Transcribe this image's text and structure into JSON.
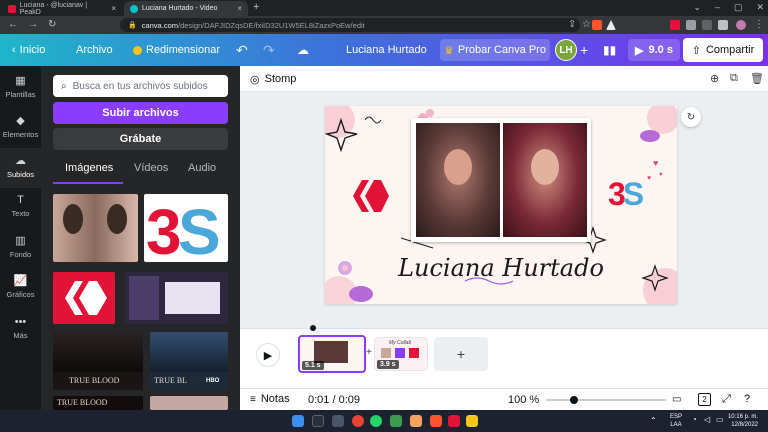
{
  "browser": {
    "tabs": [
      {
        "title": "Luciana - @lucianav | PeakD",
        "active": false
      },
      {
        "title": "Luciana Hurtado - Video",
        "active": true
      }
    ],
    "new_tab_icon": "plus-icon",
    "url_host": "canva.com",
    "url_path": "/design/DAFJIDZqsDE/fxiID32U1W5EL8iZazxPoEw/edit"
  },
  "topbar": {
    "home_label": "Inicio",
    "file_label": "Archivo",
    "resize_label": "Redimensionar",
    "doc_title": "Luciana Hurtado",
    "try_pro_label": "Probar Canva Pro",
    "avatar_initials": "LH",
    "duration_label": "9.0 s",
    "share_label": "Compartir"
  },
  "rail": {
    "items": [
      {
        "label": "Plantillas",
        "icon": "template-icon"
      },
      {
        "label": "Elementos",
        "icon": "elements-icon"
      },
      {
        "label": "Subidos",
        "icon": "cloud-upload-icon"
      },
      {
        "label": "Texto",
        "icon": "text-icon"
      },
      {
        "label": "Fondo",
        "icon": "background-icon"
      },
      {
        "label": "Gráficos",
        "icon": "chart-icon"
      },
      {
        "label": "Más",
        "icon": "more-icon"
      }
    ]
  },
  "panel": {
    "search_placeholder": "Busca en tus archivos subidos",
    "upload_label": "Subir archivos",
    "record_label": "Grábate",
    "tabs": [
      "Imágenes",
      "Vídeos",
      "Audio"
    ],
    "thumb_labels": [
      "TRUE BLOOD",
      "TRUE BL",
      "HBO",
      "TRUE BLOOD"
    ]
  },
  "workspace": {
    "animation_label": "Stomp",
    "slide_title": "Luciana Hurtado",
    "logo_text": "3S"
  },
  "timeline": {
    "clip1_duration": "5.1 s",
    "clip2_duration": "3.9 s",
    "clip2_caption": "My Collab"
  },
  "bottombar": {
    "notes_label": "Notas",
    "time_readout": "0:01 / 0:09",
    "zoom_label": "100 %",
    "page_count": "2"
  },
  "taskbar": {
    "lang": "ESP",
    "lang2": "LAA",
    "time": "10:16 p. m.",
    "date": "12/8/2022"
  },
  "colors": {
    "canva_purple": "#8b3dff",
    "gradient_start": "#1fb6c9",
    "gradient_end": "#7b2ff0",
    "hive_red": "#e31337"
  }
}
